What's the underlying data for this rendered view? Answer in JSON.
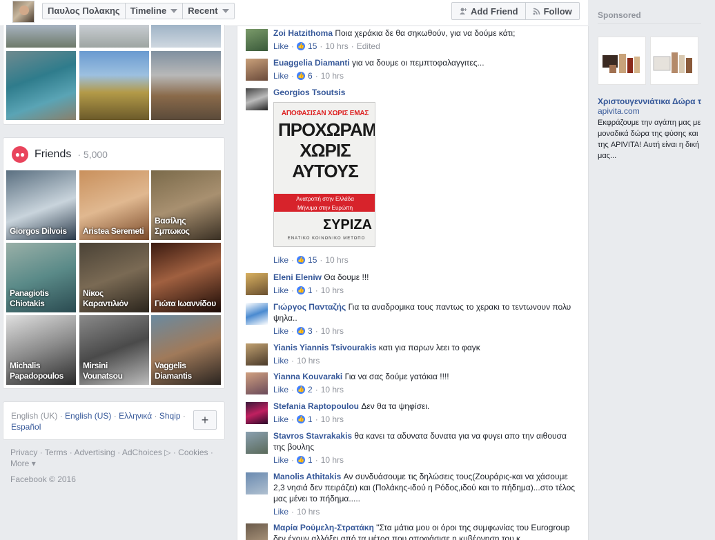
{
  "header": {
    "name": "Παυλος Πολακης",
    "timeline": "Timeline",
    "recent": "Recent",
    "add_friend": "Add Friend",
    "follow": "Follow"
  },
  "friends": {
    "title": "Friends",
    "count": "· 5,000",
    "tiles": [
      {
        "name": "Giorgos Dilvois"
      },
      {
        "name": "Aristea Seremeti"
      },
      {
        "name": "Βασίλης Σμπωκος"
      },
      {
        "name": "Panagiotis Chiotakis"
      },
      {
        "name": "Νίκος Καραντιλιόν"
      },
      {
        "name": "Γιώτα Ιωαννίδου"
      },
      {
        "name": "Michalis Papadopoulos"
      },
      {
        "name": "Mirsini Vounatsou"
      },
      {
        "name": "Vaggelis Diamantis"
      }
    ]
  },
  "languages": {
    "current": "English (UK)",
    "options": [
      "English (US)",
      "Ελληνικά",
      "Shqip",
      "Español"
    ],
    "plus": "+"
  },
  "footer": {
    "links": [
      "Privacy",
      "Terms",
      "Advertising",
      "AdChoices",
      "Cookies",
      "More"
    ],
    "copyright": "Facebook © 2016"
  },
  "comments": [
    {
      "name": "Zoi Hatzithoma",
      "text": "Ποια χεράκια δε θα σηκωθούν, για να δούμε κάτι;",
      "like": "Like",
      "count": "15",
      "time": "10 hrs",
      "extra": "Edited"
    },
    {
      "name": "Euaggelia Diamanti",
      "text": "για να δουμε οι πεμπτοφαλαγγιτες...",
      "like": "Like",
      "count": "6",
      "time": "10 hrs"
    },
    {
      "name": "Georgios Tsoutsis",
      "text": "",
      "like": "Like",
      "count": "15",
      "time": "10 hrs"
    },
    {
      "name": "Eleni Eleniw",
      "text": "Θα δουμε !!!",
      "like": "Like",
      "count": "1",
      "time": "10 hrs"
    },
    {
      "name": "Γιώργος Πανταζής",
      "text": "Για τα αναδρομικα τους παντως το χερακι το τεντωνουν πολυ ψηλα..",
      "like": "Like",
      "count": "3",
      "time": "10 hrs"
    },
    {
      "name": "Yianis Yiannis Tsivourakis",
      "text": "κατι για παρων λεει το φαγκ",
      "like": "Like",
      "time": "10 hrs"
    },
    {
      "name": "Yianna Kouvaraki",
      "text": "Για να σας δούμε γατάκια !!!!",
      "like": "Like",
      "count": "2",
      "time": "10 hrs"
    },
    {
      "name": "Stefania Raptopoulou",
      "text": "Δεν θα τα ψηφίσει.",
      "like": "Like",
      "count": "1",
      "time": "10 hrs"
    },
    {
      "name": "Stavros Stavrakakis",
      "text": "θα κανει τα αδυνατα δυνατα για να φυγει απο την αιθουσα της βουλης",
      "like": "Like",
      "count": "1",
      "time": "10 hrs"
    },
    {
      "name": "Manolis Athitakis",
      "text": "Αν συνδυάσουμε τις δηλώσεις τους(Ζουράρις-και να χάσουμε 2,3 νησιά δεν πειράζει) και (Πολάκης-ιδού η Ρόδος,ιδού και το πήδημα)...στο τέλος μας μένει το πήδημα.....",
      "like": "Like",
      "time": "10 hrs"
    },
    {
      "name": "Μαρία Ρούμελη-Στρατάκη",
      "text": "\"Στα μάτια μου οι όροι της συμφωνίας του Eurogroup δεν έχουν αλλάξει από τα μέτρα που αποφάσισε η κυβέρνηση του κ"
    }
  ],
  "poster": {
    "line1": "ΑΠΟΦΑΣΙΣΑΝ ΧΩΡΙΣ ΕΜΑΣ",
    "line2": "ΠΡΟΧΩΡΑΜΕ ΧΩΡΙΣ ΑΥΤΟΥΣ",
    "band1": "Ανατροπή στην Ελλάδα",
    "band2": "Μήνυμα στην Ευρώπη",
    "logo": "ΣΥΡΙΖΑ",
    "sub": "ΕΝΑΤΙΚΟ ΚΟΙΝΩΝΙΚΟ ΜΕΤΩΠΟ"
  },
  "sponsored": {
    "heading": "Sponsored",
    "title": "Χριστουγεννιάτικα Δώρα τ...",
    "domain": "apivita.com",
    "body": "Εκφράζουμε την αγάπη μας με μοναδικά δώρα της φύσης και της APIVITA! Αυτή είναι η δική μας..."
  }
}
